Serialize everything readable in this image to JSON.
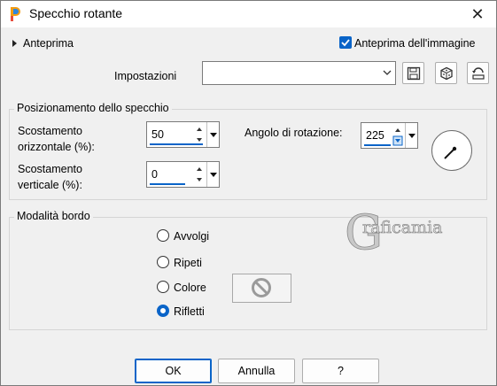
{
  "window": {
    "title": "Specchio rotante",
    "close_glyph": "✕"
  },
  "preview": {
    "label": "Anteprima",
    "image_preview_label": "Anteprima dell'immagine",
    "image_preview_checked": true
  },
  "settings": {
    "label": "Impostazioni",
    "value": ""
  },
  "mirror_position": {
    "group_title": "Posizionamento dello specchio",
    "h_offset_label_1": "Scostamento",
    "h_offset_label_2": "orizzontale (%):",
    "h_offset_value": "50",
    "v_offset_label_1": "Scostamento",
    "v_offset_label_2": "verticale (%):",
    "v_offset_value": "0",
    "rotation_label": "Angolo di rotazione:",
    "rotation_value": "225"
  },
  "edge_mode": {
    "group_title": "Modalità bordo",
    "options": [
      "Avvolgi",
      "Ripeti",
      "Colore",
      "Rifletti"
    ],
    "selected": "Rifletti"
  },
  "watermark": {
    "text": "raficamia",
    "initial": "G"
  },
  "buttons": {
    "ok": "OK",
    "cancel": "Annulla",
    "help": "?"
  },
  "colors": {
    "accent": "#0a64c8",
    "background": "#f0f0f0"
  }
}
